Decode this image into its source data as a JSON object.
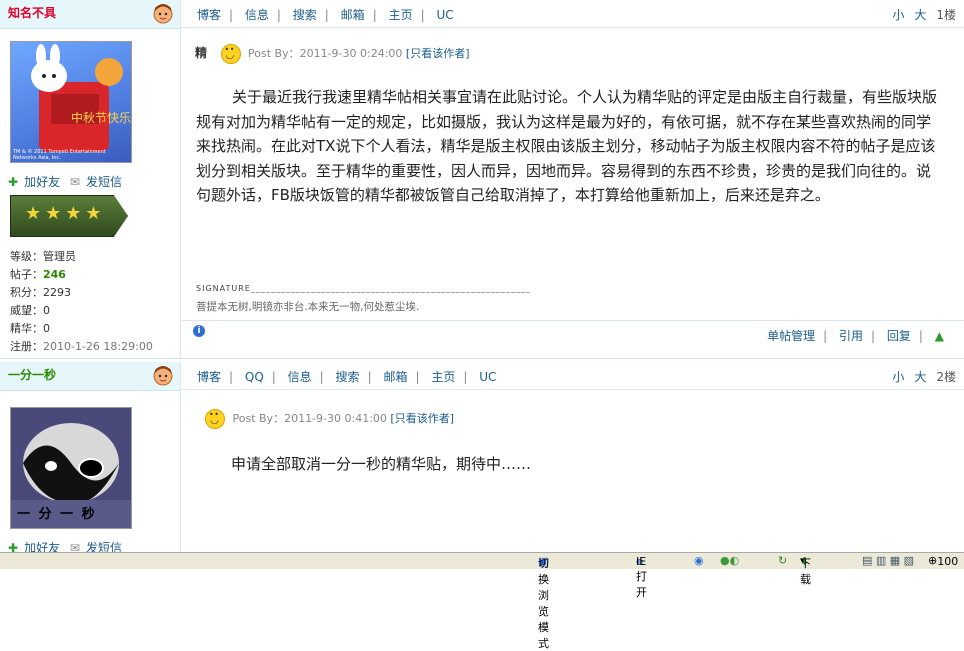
{
  "nav1": [
    "博客",
    "信息",
    "搜索",
    "邮箱",
    "主页",
    "UC"
  ],
  "nav2": [
    "博客",
    "QQ",
    "信息",
    "搜索",
    "邮箱",
    "主页",
    "UC"
  ],
  "font_small": "小",
  "font_large": "大",
  "post1": {
    "username": "知名不具",
    "avatar_caption": "TM & © 2011 Tumyeti Entertainment Networks Asia, Inc.",
    "add_friend": "加好友",
    "send_msg": "发短信",
    "stats": [
      {
        "k": "等级：",
        "v": "管理员"
      },
      {
        "k": "帖子：",
        "v": "246"
      },
      {
        "k": "积分：",
        "v": "2293"
      },
      {
        "k": "威望：",
        "v": "0"
      },
      {
        "k": "精华：",
        "v": "0"
      },
      {
        "k": "注册：",
        "v": "2010-1-26 18:29:00"
      }
    ],
    "floor": "1楼",
    "badge": "精",
    "meta": "Post By：2011-9-30 0:24:00",
    "only_author": "[只看该作者]",
    "content": "关于最近我行我速里精华帖相关事宜请在此贴讨论。个人认为精华贴的评定是由版主自行裁量，有些版块版规有对加为精华帖有一定的规定，比如摄版，我认为这样是最为好的，有依可据，就不存在某些喜欢热闹的同学来找热闹。在此对TX说下个人看法，精华是版主权限由该版主划分，移动帖子为版主权限内容不符的帖子是应该划分到相关版块。至于精华的重要性，因人而异，因地而异。容易得到的东西不珍贵，珍贵的是我们向往的。说句题外话，FB版块饭管的精华都被饭管自己给取消掉了，本打算给他重新加上，后来还是弃之。",
    "signature_label": "SIGNATURE",
    "signature": "菩提本无树,明镜亦非台.本来无一物,何处惹尘埃.",
    "ops": [
      "单帖管理",
      "引用",
      "回复"
    ]
  },
  "post2": {
    "username": "一分一秒",
    "avatar_text": "一 分 一 秒",
    "add_friend": "加好友",
    "send_msg": "发短信",
    "floor": "2楼",
    "meta": "Post By：2011-9-30 0:41:00",
    "only_author": "[只看该作者]",
    "content": "申请全部取消一分一秒的精华贴，期待中……"
  },
  "statusbar": {
    "switch_mode": "切换浏览模式",
    "ie_open": "IE打开",
    "download": "下载",
    "zoom": "100"
  },
  "colors": {
    "username_red": "#e0002a",
    "link_blue": "#1c5d8c",
    "header_bg": "#e6f7fb"
  }
}
